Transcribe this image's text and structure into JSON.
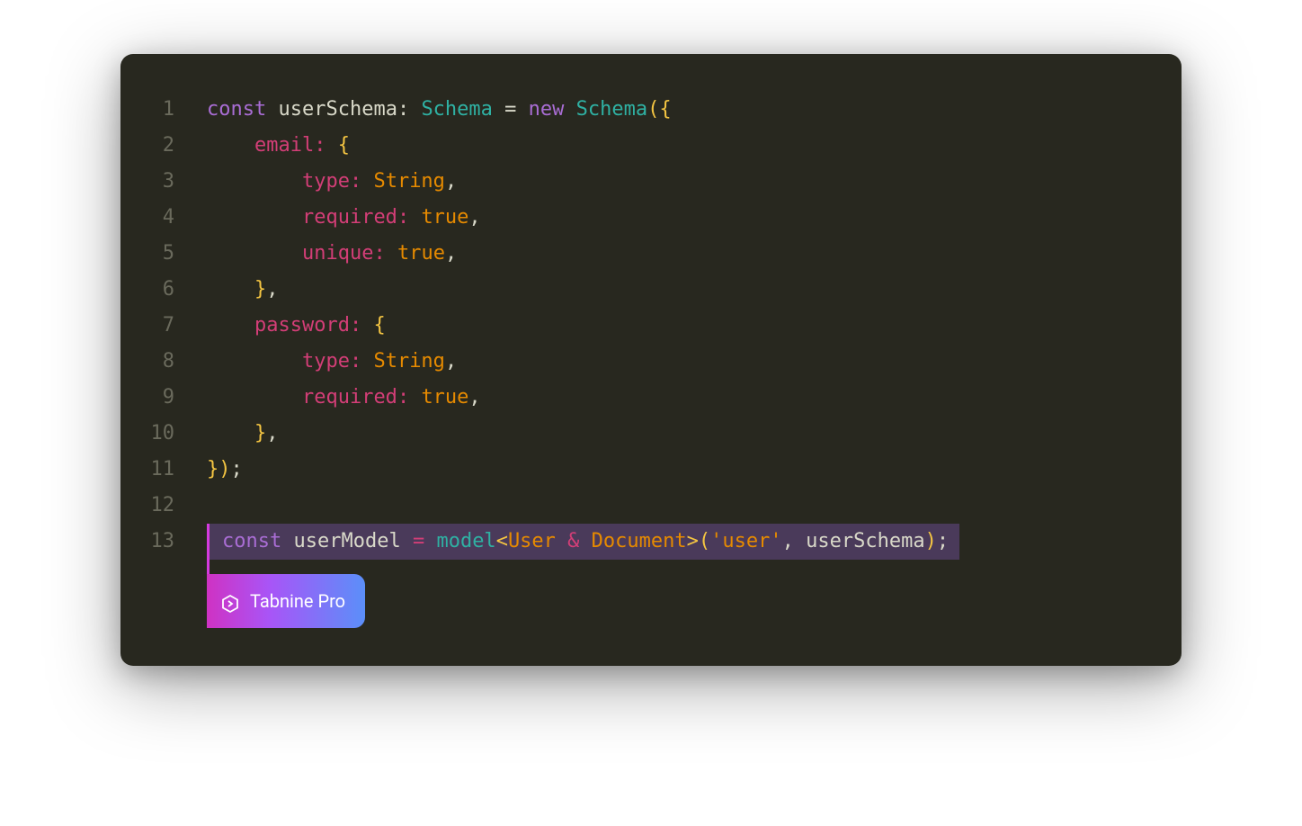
{
  "editor": {
    "lines": [
      {
        "num": "1",
        "segments": [
          {
            "t": "const",
            "c": "tok-keyword"
          },
          {
            "t": " ",
            "c": ""
          },
          {
            "t": "userSchema",
            "c": "tok-varname"
          },
          {
            "t": ":",
            "c": "tok-punct"
          },
          {
            "t": " ",
            "c": ""
          },
          {
            "t": "Schema",
            "c": "tok-type"
          },
          {
            "t": " ",
            "c": ""
          },
          {
            "t": "=",
            "c": "tok-punct"
          },
          {
            "t": " ",
            "c": ""
          },
          {
            "t": "new",
            "c": "tok-keyword"
          },
          {
            "t": " ",
            "c": ""
          },
          {
            "t": "Schema",
            "c": "tok-type"
          },
          {
            "t": "(",
            "c": "tok-brace"
          },
          {
            "t": "{",
            "c": "tok-brace"
          }
        ]
      },
      {
        "num": "2",
        "segments": [
          {
            "t": "    ",
            "c": ""
          },
          {
            "t": "email",
            "c": "tok-prop"
          },
          {
            "t": ":",
            "c": "tok-colon"
          },
          {
            "t": " ",
            "c": ""
          },
          {
            "t": "{",
            "c": "tok-brace"
          }
        ]
      },
      {
        "num": "3",
        "segments": [
          {
            "t": "        ",
            "c": ""
          },
          {
            "t": "type",
            "c": "tok-prop"
          },
          {
            "t": ":",
            "c": "tok-colon"
          },
          {
            "t": " ",
            "c": ""
          },
          {
            "t": "String",
            "c": "tok-string"
          },
          {
            "t": ",",
            "c": "tok-comma"
          }
        ]
      },
      {
        "num": "4",
        "segments": [
          {
            "t": "        ",
            "c": ""
          },
          {
            "t": "required",
            "c": "tok-prop"
          },
          {
            "t": ":",
            "c": "tok-colon"
          },
          {
            "t": " ",
            "c": ""
          },
          {
            "t": "true",
            "c": "tok-string"
          },
          {
            "t": ",",
            "c": "tok-comma"
          }
        ]
      },
      {
        "num": "5",
        "segments": [
          {
            "t": "        ",
            "c": ""
          },
          {
            "t": "unique",
            "c": "tok-prop"
          },
          {
            "t": ":",
            "c": "tok-colon"
          },
          {
            "t": " ",
            "c": ""
          },
          {
            "t": "true",
            "c": "tok-string"
          },
          {
            "t": ",",
            "c": "tok-comma"
          }
        ]
      },
      {
        "num": "6",
        "segments": [
          {
            "t": "    ",
            "c": ""
          },
          {
            "t": "}",
            "c": "tok-brace"
          },
          {
            "t": ",",
            "c": "tok-comma"
          }
        ]
      },
      {
        "num": "7",
        "segments": [
          {
            "t": "    ",
            "c": ""
          },
          {
            "t": "password",
            "c": "tok-prop"
          },
          {
            "t": ":",
            "c": "tok-colon"
          },
          {
            "t": " ",
            "c": ""
          },
          {
            "t": "{",
            "c": "tok-brace"
          }
        ]
      },
      {
        "num": "8",
        "segments": [
          {
            "t": "        ",
            "c": ""
          },
          {
            "t": "type",
            "c": "tok-prop"
          },
          {
            "t": ":",
            "c": "tok-colon"
          },
          {
            "t": " ",
            "c": ""
          },
          {
            "t": "String",
            "c": "tok-string"
          },
          {
            "t": ",",
            "c": "tok-comma"
          }
        ]
      },
      {
        "num": "9",
        "segments": [
          {
            "t": "        ",
            "c": ""
          },
          {
            "t": "required",
            "c": "tok-prop"
          },
          {
            "t": ":",
            "c": "tok-colon"
          },
          {
            "t": " ",
            "c": ""
          },
          {
            "t": "true",
            "c": "tok-string"
          },
          {
            "t": ",",
            "c": "tok-comma"
          }
        ]
      },
      {
        "num": "10",
        "segments": [
          {
            "t": "    ",
            "c": ""
          },
          {
            "t": "}",
            "c": "tok-brace"
          },
          {
            "t": ",",
            "c": "tok-comma"
          }
        ]
      },
      {
        "num": "11",
        "segments": [
          {
            "t": "}",
            "c": "tok-brace"
          },
          {
            "t": ")",
            "c": "tok-brace"
          },
          {
            "t": ";",
            "c": "tok-punct"
          }
        ]
      },
      {
        "num": "12",
        "segments": []
      }
    ],
    "suggestion_line_num": "13",
    "suggestion": [
      {
        "t": "const",
        "c": "s-keyword"
      },
      {
        "t": " ",
        "c": ""
      },
      {
        "t": "userModel",
        "c": "s-var"
      },
      {
        "t": " ",
        "c": ""
      },
      {
        "t": "=",
        "c": "s-op"
      },
      {
        "t": " ",
        "c": ""
      },
      {
        "t": "model",
        "c": "s-func"
      },
      {
        "t": "<",
        "c": "s-angle"
      },
      {
        "t": "User",
        "c": "s-type"
      },
      {
        "t": " ",
        "c": ""
      },
      {
        "t": "&",
        "c": "s-amp"
      },
      {
        "t": " ",
        "c": ""
      },
      {
        "t": "Document",
        "c": "s-type"
      },
      {
        "t": ">",
        "c": "s-angle"
      },
      {
        "t": "(",
        "c": "s-paren"
      },
      {
        "t": "'user'",
        "c": "s-str"
      },
      {
        "t": ",",
        "c": "s-punct"
      },
      {
        "t": " ",
        "c": ""
      },
      {
        "t": "userSchema",
        "c": "s-var"
      },
      {
        "t": ")",
        "c": "s-paren"
      },
      {
        "t": ";",
        "c": "s-punct"
      }
    ],
    "badge_label": "Tabnine Pro"
  }
}
